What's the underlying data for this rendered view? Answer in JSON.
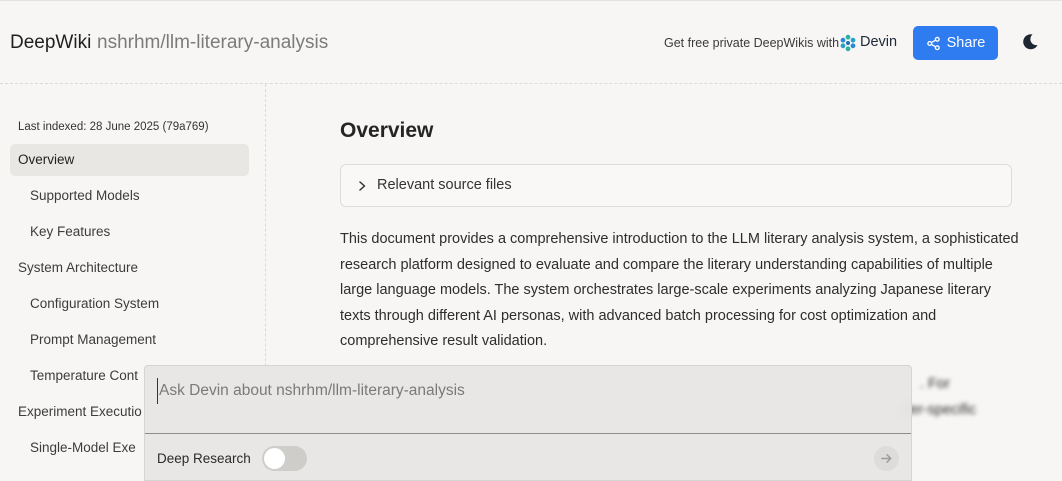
{
  "header": {
    "brand": "DeepWiki",
    "repo": "nshrhm/llm-literary-analysis",
    "promo": "Get free private DeepWikis with",
    "devin_label": "Devin",
    "share_label": "Share",
    "theme_icon": "moon-icon"
  },
  "sidebar": {
    "last_indexed": "Last indexed: 28 June 2025 (79a769)",
    "items": [
      {
        "label": "Overview",
        "active": true
      },
      {
        "label": "Supported Models"
      },
      {
        "label": "Key Features"
      },
      {
        "label": "System Architecture"
      },
      {
        "label": "Configuration System"
      },
      {
        "label": "Prompt Management"
      },
      {
        "label": "Temperature Cont"
      },
      {
        "label": "Experiment Executio"
      },
      {
        "label": "Single-Model Exe"
      }
    ]
  },
  "main": {
    "title": "Overview",
    "source_files_label": "Relevant source files",
    "paragraph": "This document provides a comprehensive introduction to the LLM literary analysis system, a sophisticated research platform designed to evaluate and compare the literary understanding capabilities of multiple large language models. The system orchestrates large-scale experiments analyzing Japanese literary texts through different AI personas, with advanced batch processing for cost optimization and comprehensive result validation.",
    "paragraph2_visible": [
      ". For",
      "der-specific"
    ]
  },
  "ask": {
    "placeholder": "Ask Devin about nshrhm/llm-literary-analysis",
    "deep_research_label": "Deep Research",
    "deep_research_on": false
  },
  "colors": {
    "accent": "#2f7bf0",
    "background": "#f7f6f4"
  }
}
